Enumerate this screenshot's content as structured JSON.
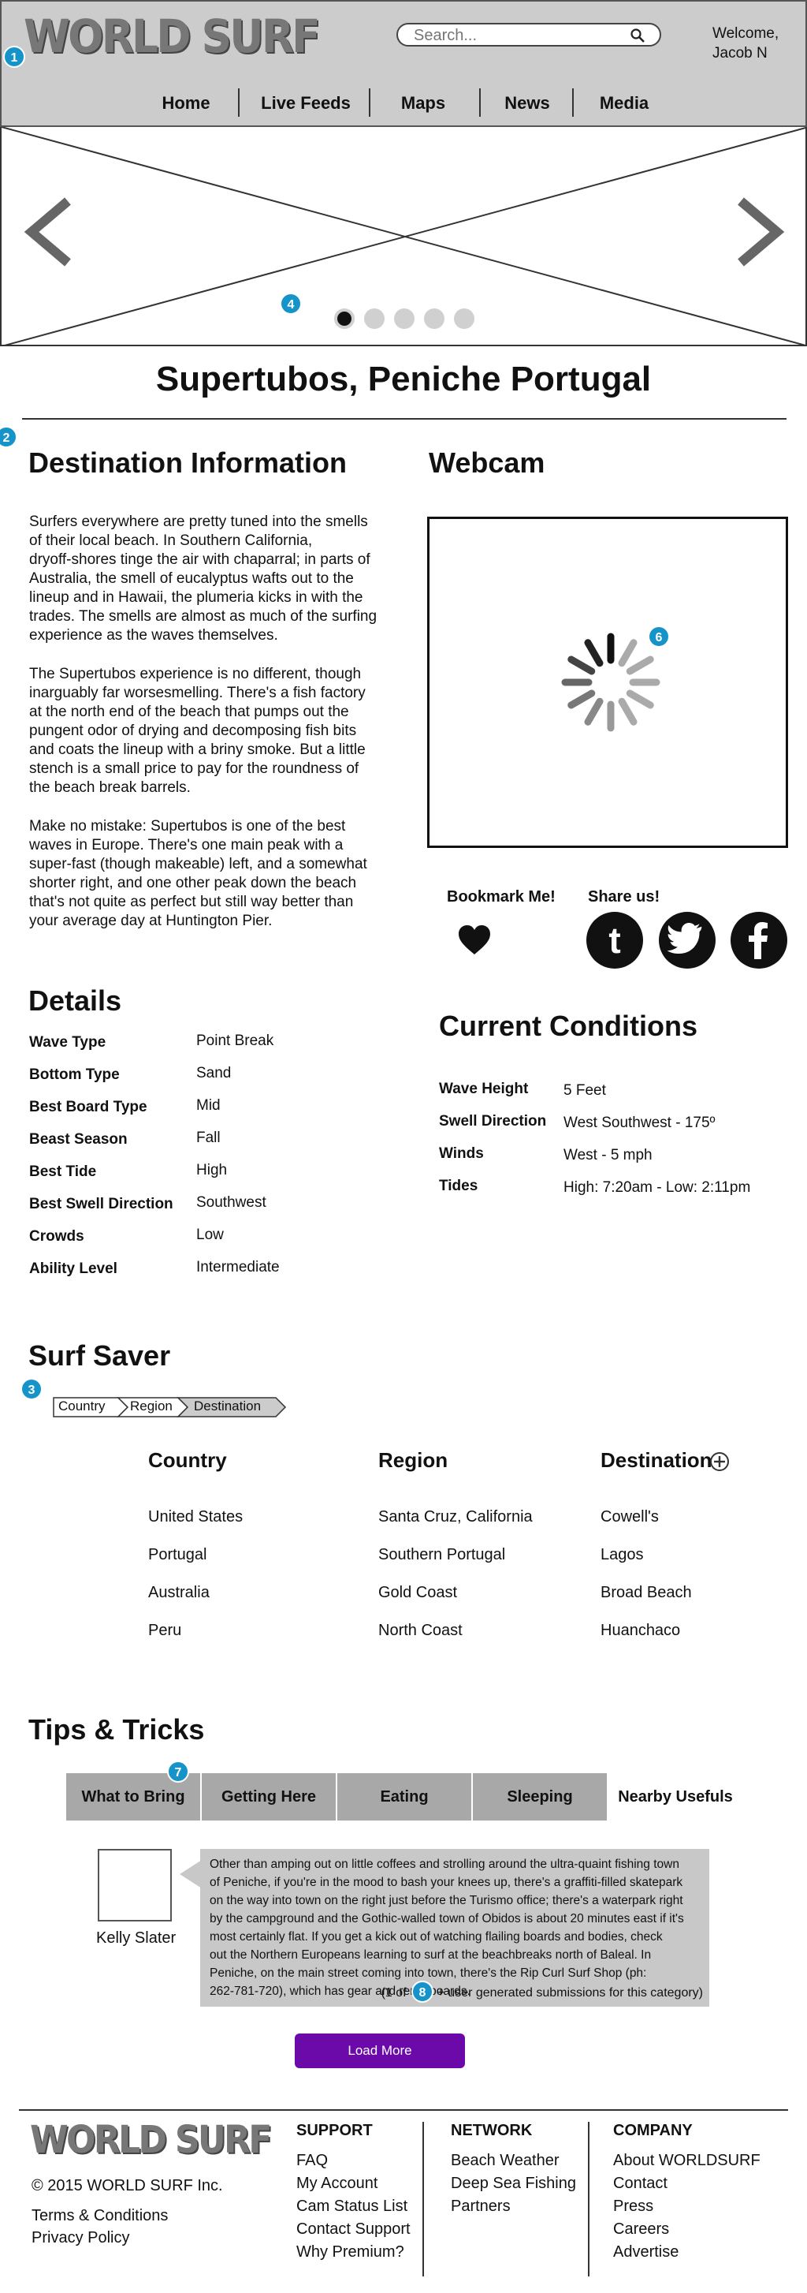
{
  "header": {
    "logo": "WORLD SURF",
    "search_placeholder": "Search...",
    "welcome_line1": "Welcome,",
    "welcome_line2": "Jacob N",
    "nav": [
      "Home",
      "Live Feeds",
      "Maps",
      "News",
      "Media"
    ]
  },
  "markers": [
    "1",
    "2",
    "3",
    "4",
    "6",
    "7",
    "8"
  ],
  "page_title": "Supertubos, Peniche Portugal",
  "destination": {
    "heading": "Destination Information",
    "p1": [
      "Surfers everywhere are pretty tuned into the smells",
      "of their local beach. In Southern California,",
      "dryoff-shores tinge the air with chaparral; in parts of",
      "Australia, the smell of eucalyptus wafts out to the",
      "lineup and in Hawaii, the plumeria kicks in with the",
      "trades. The smells are almost as much of the surfing",
      "experience as the waves themselves."
    ],
    "p2": [
      "The Supertubos experience is no different, though",
      "inarguably far worsesmelling. There's a fish factory",
      "at the north end of the beach that pumps out the",
      "pungent odor of drying and decomposing fish bits",
      "and coats the lineup with a briny smoke. But a little",
      "stench is a small price to pay for the roundness of",
      "the beach break barrels."
    ],
    "p3": [
      "Make no mistake: Supertubos is one of the best",
      "waves in Europe. There's one main peak with a",
      "super-fast (though makeable) left, and a somewhat",
      "shorter right, and one other peak down the beach",
      "that's  not quite as perfect but still way better than",
      "your average day at Huntington Pier."
    ]
  },
  "webcam": {
    "heading": "Webcam"
  },
  "bookmark": {
    "label": "Bookmark Me!"
  },
  "share": {
    "label": "Share us!",
    "icons": [
      "tumblr-icon",
      "twitter-icon",
      "facebook-icon"
    ]
  },
  "details": {
    "heading": "Details",
    "rows": [
      {
        "label": "Wave Type",
        "value": "Point Break"
      },
      {
        "label": "Bottom Type",
        "value": "Sand"
      },
      {
        "label": "Best Board Type",
        "value": "Mid"
      },
      {
        "label": "Beast Season",
        "value": "Fall"
      },
      {
        "label": "Best Tide",
        "value": "High"
      },
      {
        "label": "Best Swell Direction",
        "value": "Southwest"
      },
      {
        "label": "Crowds",
        "value": "Low"
      },
      {
        "label": "Ability Level",
        "value": "Intermediate"
      }
    ]
  },
  "conditions": {
    "heading": "Current Conditions",
    "rows": [
      {
        "label": "Wave Height",
        "value": "5 Feet"
      },
      {
        "label": "Swell Direction",
        "value": "West Southwest - 175º"
      },
      {
        "label": "Winds",
        "value": "West - 5 mph"
      },
      {
        "label": "Tides",
        "value": "High: 7:20am - Low: 2:11pm"
      }
    ]
  },
  "surf_saver": {
    "heading": "Surf Saver",
    "breadcrumb": [
      "Country",
      "Region",
      "Destination"
    ],
    "columns": [
      {
        "heading": "Country",
        "items": [
          "United States",
          "Portugal",
          "Australia",
          "Peru"
        ]
      },
      {
        "heading": "Region",
        "items": [
          "Santa Cruz, California",
          "Southern Portugal",
          "Gold Coast",
          "North Coast"
        ]
      },
      {
        "heading": "Destination",
        "items": [
          "Cowell's",
          "Lagos",
          "Broad Beach",
          "Huanchaco"
        ]
      }
    ]
  },
  "tips": {
    "heading": "Tips & Tricks",
    "tabs": [
      "What to Bring",
      "Getting Here",
      "Eating",
      "Sleeping",
      "Nearby Usefuls"
    ],
    "author": "Kelly Slater",
    "comment": [
      "Other than amping out on little coffees and strolling around the ultra-quaint fishing town",
      "of Peniche, if you're in the mood to bash your knees up, there's a graffiti-filled skatepark",
      "on the way into town on the right just before the Turismo office; there's a waterpark right",
      "by the campground and the Gothic-walled town of Obidos is about 20 minutes east if it's",
      "most certainly flat. If you get a kick out of watching flailing boards and bodies, check",
      "out the Northern Europeans learning to surf at the beachbreaks north of Baleal. In",
      "Peniche, on the main street coming into town, there's the Rip Curl Surf Shop (ph:",
      "262-781-720), which has gear and rents boards."
    ],
    "count_prefix": "(1 of",
    "count_suffix": "+ user generated submissions for this category)",
    "load_more": "Load More"
  },
  "footer": {
    "logo": "WORLD SURF",
    "copyright": "© 2015 WORLD SURF Inc.",
    "legal": [
      "Terms & Conditions",
      "Privacy Policy"
    ],
    "columns": [
      {
        "heading": "SUPPORT",
        "items": [
          "FAQ",
          "My Account",
          "Cam Status List",
          "Contact Support",
          "Why Premium?"
        ]
      },
      {
        "heading": "NETWORK",
        "items": [
          "Beach Weather",
          "Deep Sea Fishing",
          "Partners"
        ]
      },
      {
        "heading": "COMPANY",
        "items": [
          "About WORLDSURF",
          "Contact",
          "Press",
          "Careers",
          "Advertise"
        ]
      }
    ]
  },
  "colors": {
    "header_bg": "#cccccc",
    "marker": "#1694c9",
    "button": "#6b0aa8",
    "tab": "#a8a8a8",
    "bubble": "#c8c8c8"
  }
}
